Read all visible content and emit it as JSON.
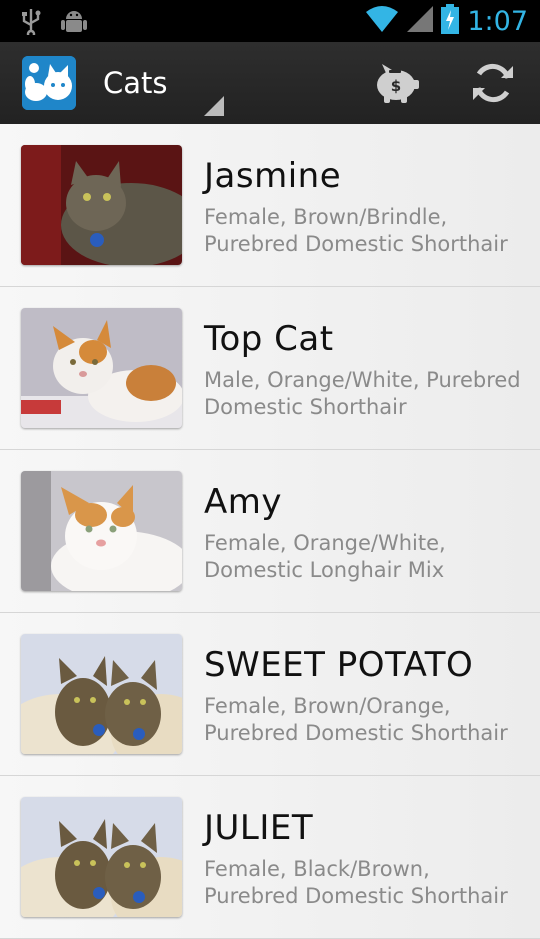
{
  "status_bar": {
    "time": "1:07",
    "icons": [
      "usb-icon",
      "android-debug-icon",
      "wifi-icon",
      "signal-icon",
      "battery-charging-icon"
    ]
  },
  "action_bar": {
    "title": "Cats",
    "logo_icon": "app-logo-icon",
    "actions": [
      {
        "name": "donate-button",
        "icon": "piggy-bank-icon"
      },
      {
        "name": "refresh-button",
        "icon": "refresh-icon"
      }
    ]
  },
  "pets": [
    {
      "name": "Jasmine",
      "description": "Female, Brown/Brindle, Purebred Domestic Shorthair"
    },
    {
      "name": "Top Cat",
      "description": "Male, Orange/White, Purebred Domestic Shorthair"
    },
    {
      "name": "Amy",
      "description": "Female, Orange/White, Domestic Longhair Mix"
    },
    {
      "name": "SWEET POTATO",
      "description": "Female, Brown/Orange, Purebred Domestic Shorthair"
    },
    {
      "name": "JULIET",
      "description": "Female, Black/Brown, Purebred Domestic Shorthair"
    }
  ],
  "colors": {
    "accent": "#33b5e5",
    "action_bar": "#2a2a2a",
    "logo_blue": "#1f86c9"
  }
}
